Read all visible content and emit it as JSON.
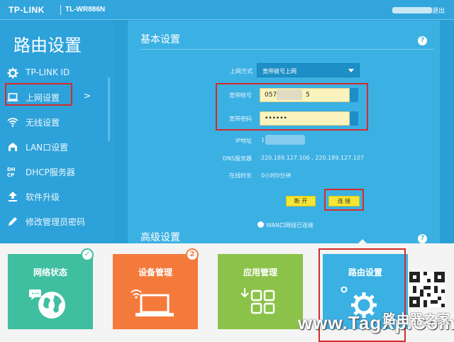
{
  "header": {
    "brand": "TP-LINK",
    "model": "TL-WR886N",
    "logout_label": "退出"
  },
  "sidebar": {
    "title": "路由设置",
    "items": [
      {
        "label": "TP-LINK ID",
        "icon": "gear-icon"
      },
      {
        "label": "上网设置",
        "icon": "laptop-icon",
        "chevron": ">"
      },
      {
        "label": "无线设置",
        "icon": "wifi-icon"
      },
      {
        "label": "LAN口设置",
        "icon": "lan-icon"
      },
      {
        "label": "DHCP服务器",
        "icon": "dhcp-icon"
      },
      {
        "label": "软件升级",
        "icon": "upload-icon"
      },
      {
        "label": "修改管理员密码",
        "icon": "pencil-icon"
      }
    ]
  },
  "basic": {
    "title": "基本设置",
    "help": "?",
    "connection_type_label": "上网方式",
    "connection_type_value": "宽带拨号上网",
    "account_label": "宽带帐号",
    "account_value_prefix": "057",
    "account_value_suffix": "5",
    "password_label": "宽带密码",
    "password_value": "••••••",
    "ip_label": "IP地址",
    "ip_value": "1",
    "dns_label": "DNS服务器",
    "dns_value": "220.189.127.106 , 220.189.127.107",
    "online_label": "在线时长",
    "online_value": "0小时0分钟",
    "refresh_button": "断 开",
    "connect_button": "连 接",
    "wan_status": "WAN口网线已连接"
  },
  "advanced": {
    "title": "高级设置",
    "help": "?"
  },
  "tiles": [
    {
      "label": "网络状态",
      "color": "#3fbfa0",
      "icon": "globe-icon",
      "badge": "✓",
      "badge_color": "#3fbfa0"
    },
    {
      "label": "设备管理",
      "color": "#f47a3c",
      "icon": "laptop-wifi-icon",
      "badge": "2",
      "badge_color": "#f47a3c"
    },
    {
      "label": "应用管理",
      "color": "#8bc34a",
      "icon": "apps-grid-icon"
    },
    {
      "label": "路由设置",
      "color": "#3bb0e3",
      "icon": "settings-gears-icon"
    }
  ],
  "colors": {
    "accent": "#2da2da",
    "highlight_box": "#d42b2b",
    "button_yellow": "#f5e534",
    "input_fill": "#fbf3bd"
  },
  "watermark": {
    "text_cn": "路由器之家",
    "text_en": "www.TagXp.Com"
  }
}
